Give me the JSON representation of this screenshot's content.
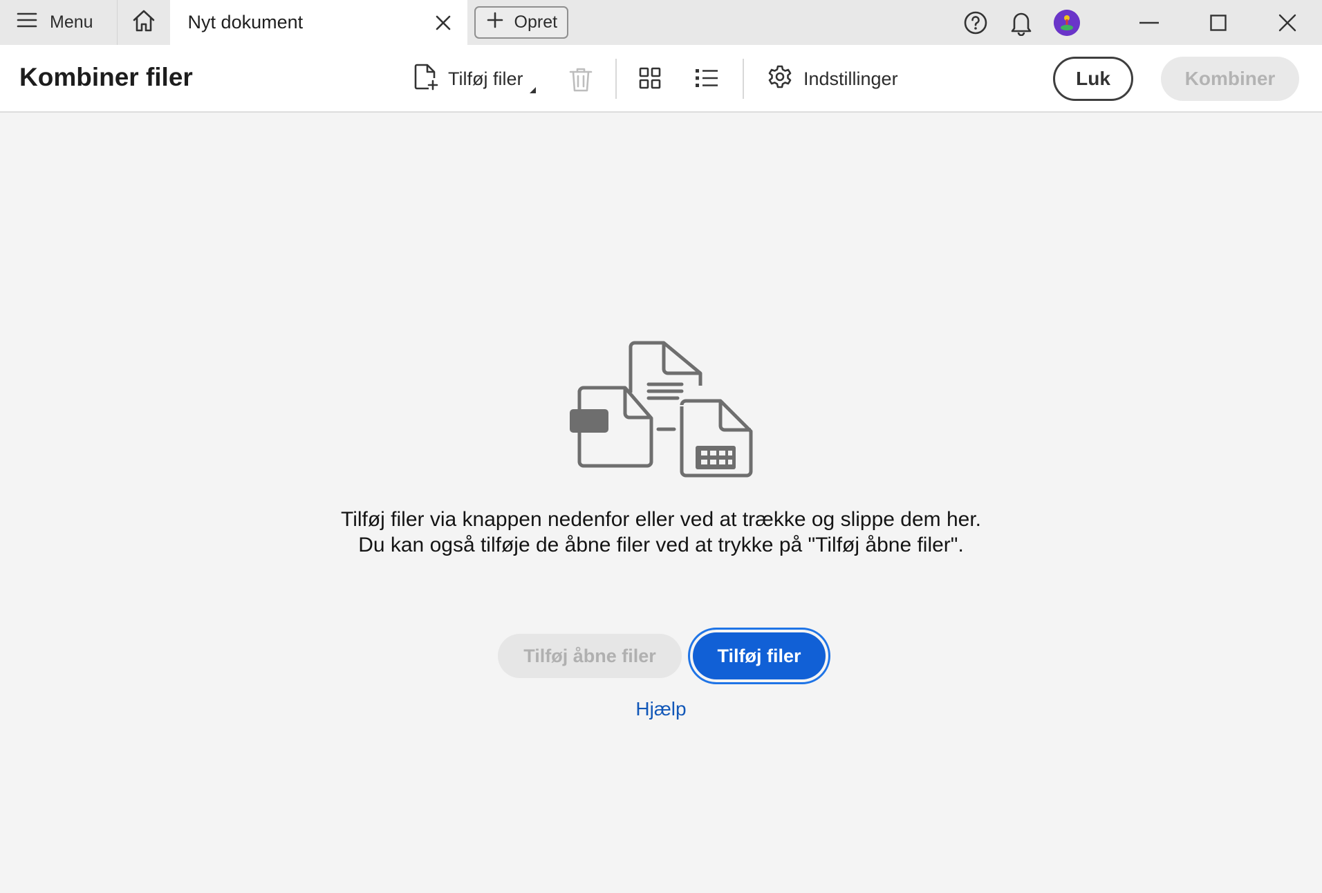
{
  "titlebar": {
    "menu_label": "Menu",
    "tab_title": "Nyt dokument",
    "new_label": "Opret"
  },
  "toolbar": {
    "title": "Kombiner filer",
    "add_files_label": "Tilføj filer",
    "settings_label": "Indstillinger",
    "close_label": "Luk",
    "combine_label": "Kombiner"
  },
  "main": {
    "instruction_line1": "Tilføj filer via knappen nedenfor eller ved at trække og slippe dem her.",
    "instruction_line2": "Du kan også tilføje de åbne filer ved at trykke på \"Tilføj åbne filer\".",
    "add_open_files_label": "Tilføj åbne filer",
    "add_files_label": "Tilføj filer",
    "help_label": "Hjælp"
  },
  "colors": {
    "primary_button": "#1160d6",
    "link": "#1157b8",
    "disabled_text": "#b3b3b3"
  },
  "icons": [
    "hamburger-icon",
    "home-icon",
    "close-icon",
    "plus-icon",
    "help-icon",
    "bell-icon",
    "avatar",
    "minimize-icon",
    "maximize-icon",
    "add-file-icon",
    "trash-icon",
    "grid-view-icon",
    "list-view-icon",
    "gear-icon"
  ]
}
